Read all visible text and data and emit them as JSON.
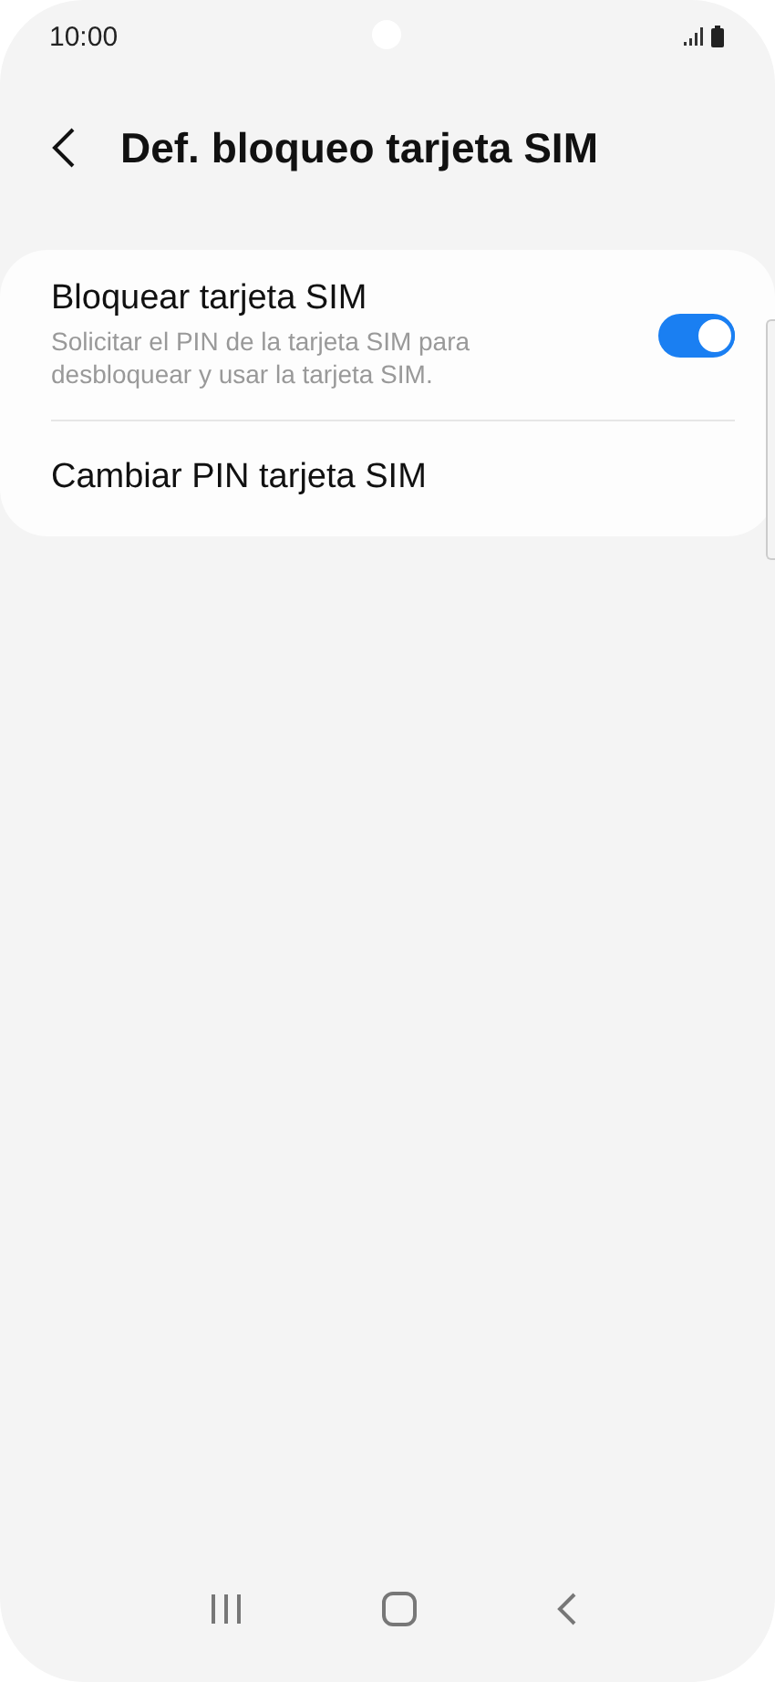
{
  "status_bar": {
    "time": "10:00"
  },
  "header": {
    "title": "Def. bloqueo tarjeta SIM"
  },
  "settings": [
    {
      "kind": "toggle",
      "title": "Bloquear tarjeta SIM",
      "subtitle": "Solicitar el PIN de la tarjeta SIM para desbloquear y usar la tarjeta SIM.",
      "on": true
    },
    {
      "kind": "link",
      "title": "Cambiar PIN tarjeta SIM"
    }
  ]
}
